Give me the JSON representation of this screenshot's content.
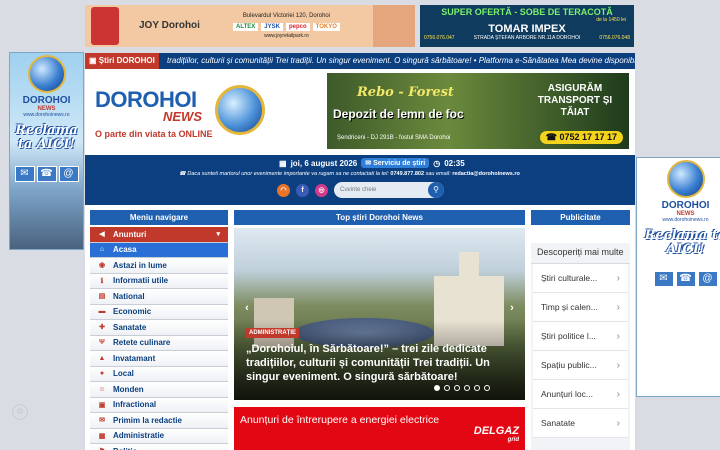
{
  "top_ad_left": {
    "logo": "JOY Dorohoi",
    "address": "Bulevardul Victoriei 120, Dorohoi",
    "stores": [
      "ALTEX",
      "JYSK",
      "pepco",
      "TOKYO"
    ],
    "url": "www.joyretailpark.ro"
  },
  "top_ad_right": {
    "headline": "SUPER OFERTĂ - SOBE DE TERACOTĂ",
    "since": "de la 1450 lei",
    "brand": "TOMAR IMPEX",
    "phone1": "0756.076.047",
    "phone2": "0756.076.048",
    "address": "STRADA ȘTEFAN ARBORE NR.11A DOROHOI"
  },
  "side_banner": {
    "brand": "DOROHOI",
    "brand_sub": "NEWS",
    "url": "www.dorohoinews.ro",
    "cta": "Reclama ta AICI!"
  },
  "ticker": {
    "label": "Știri DOROHOI",
    "text": "tradițiilor, culturii și comunității Trei tradiții. Un singur eveniment. O singură sărbătoare!   •   Platforma e-Sănătatea Mea devine disponibilă pe"
  },
  "logo": {
    "main": "DOROHOI",
    "news": "NEWS",
    "tagline": "O parte din viata ta ONLINE"
  },
  "header_ad": {
    "brand": "Rebo - Forest",
    "title": "Depozit de lemn de foc",
    "location": "Șendriceni - DJ 291B - fostul SMA Dorohoi",
    "right": "ASIGURĂM TRANSPORT ȘI TĂIAT",
    "phone": "0752 17 17 17"
  },
  "infobar": {
    "date": "joi, 6 august 2026",
    "service": "Serviciu de știri",
    "time": "02:35",
    "notice": "Daca sunteti martorul unor evenimente importante va rugam sa ne contactati la tel:",
    "phone": "0749.877.802",
    "email_label": "sau email:",
    "email": "redactia@dorohoinews.ro",
    "search_placeholder": "Cuvinte cheie"
  },
  "menu": {
    "title": "Meniu navigare",
    "items": [
      {
        "label": "Anunturi",
        "icon": "megaphone-icon",
        "glyph": "◀",
        "style": "dark"
      },
      {
        "label": "Acasa",
        "icon": "home-icon",
        "glyph": "⌂",
        "style": "active"
      },
      {
        "label": "Astazi in lume",
        "icon": "globe-icon",
        "glyph": "◉",
        "style": ""
      },
      {
        "label": "Informatii utile",
        "icon": "info-icon",
        "glyph": "ℹ",
        "style": ""
      },
      {
        "label": "National",
        "icon": "map-icon",
        "glyph": "▤",
        "style": ""
      },
      {
        "label": "Economic",
        "icon": "money-icon",
        "glyph": "▬",
        "style": ""
      },
      {
        "label": "Sanatate",
        "icon": "health-icon",
        "glyph": "✚",
        "style": ""
      },
      {
        "label": "Retete culinare",
        "icon": "utensils-icon",
        "glyph": "Ψ",
        "style": ""
      },
      {
        "label": "Invatamant",
        "icon": "graduation-icon",
        "glyph": "▲",
        "style": ""
      },
      {
        "label": "Local",
        "icon": "pin-icon",
        "glyph": "●",
        "style": ""
      },
      {
        "label": "Monden",
        "icon": "user-icon",
        "glyph": "☺",
        "style": ""
      },
      {
        "label": "Infractional",
        "icon": "alert-icon",
        "glyph": "▣",
        "style": ""
      },
      {
        "label": "Primim la redactie",
        "icon": "inbox-icon",
        "glyph": "✉",
        "style": ""
      },
      {
        "label": "Administratie",
        "icon": "building-icon",
        "glyph": "▦",
        "style": ""
      },
      {
        "label": "Politic",
        "icon": "flag-icon",
        "glyph": "⚑",
        "style": ""
      }
    ]
  },
  "center": {
    "title": "Top știri Dorohoi News",
    "slide": {
      "category": "ADMINISTRAȚIE",
      "headline": "„Dorohoiul, în Sărbătoare!” – trei zile dedicate tradițiilor, culturii și comunității Trei tradiții. Un singur eveniment. O singură sărbătoare!",
      "dots_total": 6,
      "dots_active": 1
    },
    "banner": {
      "text": "Anunțuri de întrerupere a energiei electrice",
      "logo": "DELGAZ",
      "logo_sub": "grid"
    }
  },
  "right": {
    "title": "Publicitate",
    "promo_title": "Descoperiți mai multe",
    "items": [
      "Știri culturale...",
      "Timp și calen...",
      "Știri politice l...",
      "Spațiu public...",
      "Anunțuri loc...",
      "Sanatate"
    ]
  },
  "colors": {
    "primary": "#1f5fb0",
    "dark_blue": "#0b3f80",
    "accent_red": "#c0392b",
    "delgaz_red": "#e30613"
  }
}
